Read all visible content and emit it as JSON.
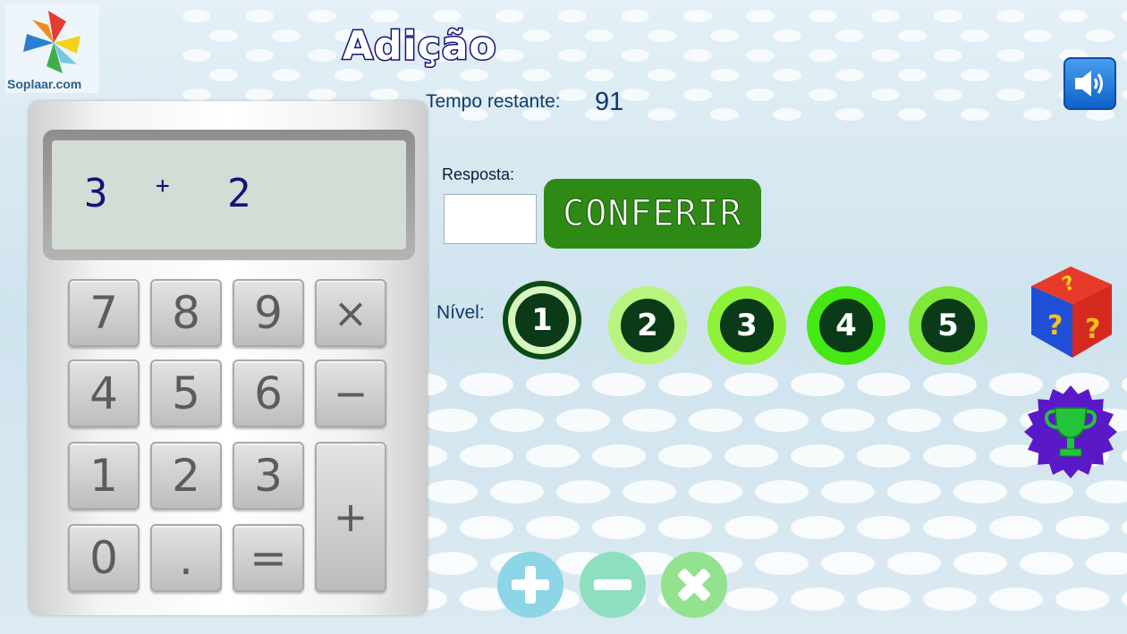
{
  "logo": {
    "icon": "pinwheel-logo-icon",
    "text": "Soplaar.com"
  },
  "title": "Adição",
  "timer": {
    "label": "Tempo restante:",
    "value": "91"
  },
  "sound": {
    "icon": "speaker-icon",
    "color": "#1b74dc"
  },
  "answer": {
    "label": "Resposta:",
    "value": "",
    "placeholder": "",
    "check_label": "CONFERIR",
    "check_color": "#2f8a15"
  },
  "level": {
    "label": "Nível:",
    "options": [
      "1",
      "2",
      "3",
      "4",
      "5"
    ],
    "selected": "1"
  },
  "calculator": {
    "display": {
      "left": "3",
      "operator": "+",
      "right": "2"
    },
    "keys": [
      "7",
      "8",
      "9",
      "×",
      "4",
      "5",
      "6",
      "−",
      "1",
      "2",
      "3",
      "+",
      "0",
      ".",
      "="
    ]
  },
  "side_icons": [
    "question-cube-icon",
    "trophy-icon"
  ],
  "operations": [
    {
      "icon": "plus-icon",
      "color": "#8cd6e6"
    },
    {
      "icon": "minus-icon",
      "color": "#8de0bf"
    },
    {
      "icon": "times-icon",
      "color": "#93e28e"
    }
  ]
}
